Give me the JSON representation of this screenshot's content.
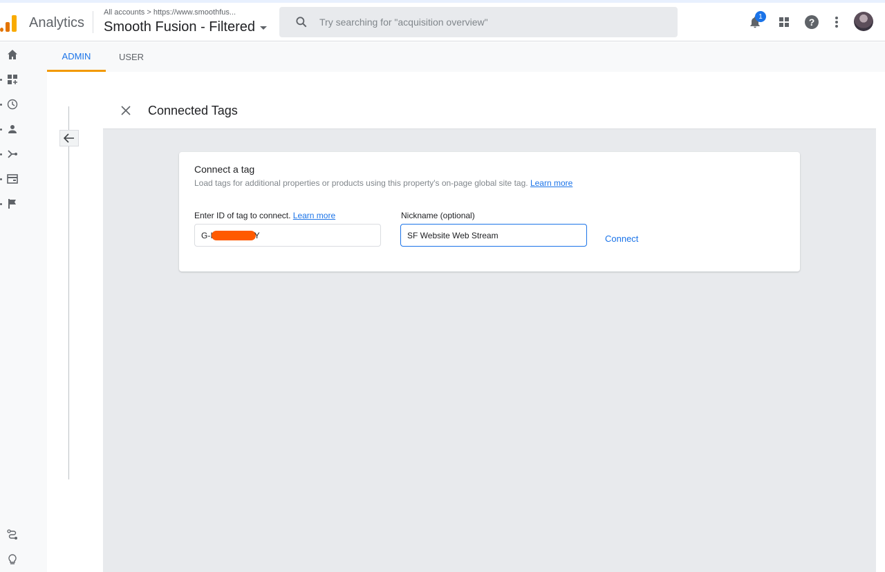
{
  "header": {
    "app_name": "Analytics",
    "breadcrumb": "All accounts > https://www.smoothfus...",
    "account_name": "Smooth Fusion - Filtered",
    "search_placeholder": "Try searching for \"acquisition overview\"",
    "notification_count": "1",
    "icons": [
      "notifications-icon",
      "apps-grid-icon",
      "help-icon",
      "more-vert-icon",
      "avatar"
    ]
  },
  "sidenav": {
    "items": [
      "home-icon",
      "customization-icon",
      "realtime-icon",
      "audience-icon",
      "acquisition-icon",
      "behavior-icon",
      "conversions-icon"
    ],
    "bottom_items": [
      "attribution-icon",
      "discover-icon"
    ]
  },
  "tabs": [
    {
      "label": "ADMIN",
      "active": true
    },
    {
      "label": "USER",
      "active": false
    }
  ],
  "panel": {
    "title": "Connected Tags",
    "card": {
      "title": "Connect a tag",
      "description": "Load tags for additional properties or products using this property's on-page global site tag.",
      "description_link": "Learn more",
      "tag_id_label": "Enter ID of tag to connect.",
      "tag_id_link": "Learn more",
      "tag_id_prefix": "G-I",
      "tag_id_suffix": "Y",
      "nickname_label": "Nickname (optional)",
      "nickname_value": "SF Website Web Stream",
      "connect_label": "Connect"
    }
  },
  "colors": {
    "accent": "#1a73e8",
    "tab_underline": "#f29900",
    "redaction": "#ff5a00"
  }
}
